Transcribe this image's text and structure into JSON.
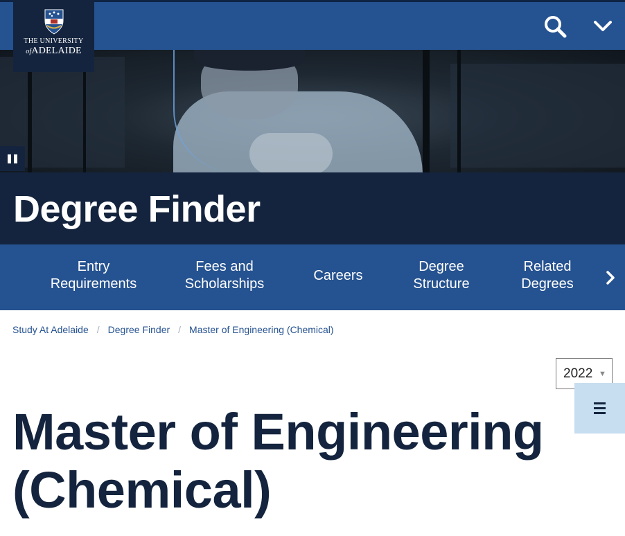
{
  "header": {
    "logo": {
      "line1": "THE UNIVERSITY",
      "prefix": "of",
      "line2": "ADELAIDE"
    },
    "search_icon": "search-icon",
    "expand_icon": "chevron-down-icon",
    "pause_icon": "pause-icon",
    "hero_image": "student working with optical fibre cables"
  },
  "page_banner": {
    "title": "Degree Finder"
  },
  "sub_nav": {
    "items": [
      {
        "label": "Entry\nRequirements"
      },
      {
        "label": "Fees and\nScholarships"
      },
      {
        "label": "Careers"
      },
      {
        "label": "Degree\nStructure"
      },
      {
        "label": "Related\nDegrees"
      }
    ],
    "next_icon": "chevron-right-icon"
  },
  "breadcrumb": {
    "items": [
      "Study At Adelaide",
      "Degree Finder",
      "Master of Engineering (Chemical)"
    ],
    "separator": "/"
  },
  "year_select": {
    "value": "2022",
    "arrow_icon": "caret-down-icon"
  },
  "menu_button": {
    "icon": "hamburger-icon"
  },
  "degree": {
    "title": "Master of Engineering (Chemical)"
  },
  "colors": {
    "navy": "#14243e",
    "blue": "#255290",
    "light_blue": "#c6deef"
  }
}
